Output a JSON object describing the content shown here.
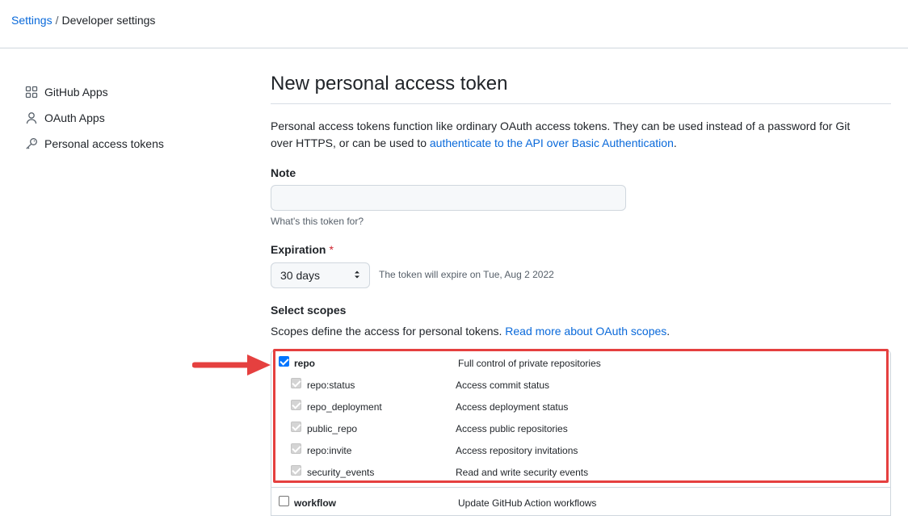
{
  "breadcrumb": {
    "settings": "Settings",
    "separator": "/",
    "current": "Developer settings"
  },
  "sidebar": {
    "items": [
      {
        "label": "GitHub Apps",
        "icon": "apps-grid-icon"
      },
      {
        "label": "OAuth Apps",
        "icon": "person-icon"
      },
      {
        "label": "Personal access tokens",
        "icon": "key-icon"
      }
    ]
  },
  "main": {
    "title": "New personal access token",
    "description_prefix": "Personal access tokens function like ordinary OAuth access tokens. They can be used instead of a password for Git over HTTPS, or can be used to ",
    "description_link": "authenticate to the API over Basic Authentication",
    "description_suffix": ".",
    "note": {
      "label": "Note",
      "value": "",
      "hint": "What's this token for?"
    },
    "expiration": {
      "label": "Expiration",
      "required_mark": "*",
      "selected": "30 days",
      "info": "The token will expire on Tue, Aug 2 2022"
    },
    "scopes": {
      "label": "Select scopes",
      "description": "Scopes define the access for personal tokens. ",
      "link": "Read more about OAuth scopes",
      "link_suffix": ".",
      "items": [
        {
          "name": "repo",
          "desc": "Full control of private repositories",
          "checked": true,
          "sub": false
        },
        {
          "name": "repo:status",
          "desc": "Access commit status",
          "checked": true,
          "sub": true
        },
        {
          "name": "repo_deployment",
          "desc": "Access deployment status",
          "checked": true,
          "sub": true
        },
        {
          "name": "public_repo",
          "desc": "Access public repositories",
          "checked": true,
          "sub": true
        },
        {
          "name": "repo:invite",
          "desc": "Access repository invitations",
          "checked": true,
          "sub": true
        },
        {
          "name": "security_events",
          "desc": "Read and write security events",
          "checked": true,
          "sub": true
        },
        {
          "name": "workflow",
          "desc": "Update GitHub Action workflows",
          "checked": false,
          "sub": false
        }
      ]
    }
  },
  "colors": {
    "link": "#0969da",
    "highlight": "#e5403f",
    "checkbox_checked": "#0075ff",
    "required": "#cf222e"
  }
}
